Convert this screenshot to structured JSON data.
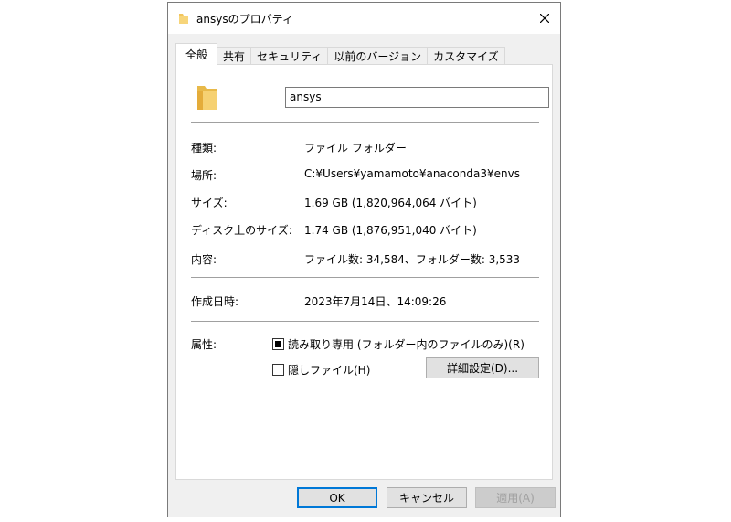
{
  "window": {
    "title": "ansysのプロパティ"
  },
  "tabs": [
    {
      "label": "全般"
    },
    {
      "label": "共有"
    },
    {
      "label": "セキュリティ"
    },
    {
      "label": "以前のバージョン"
    },
    {
      "label": "カスタマイズ"
    }
  ],
  "general": {
    "folder_name": "ansys",
    "rows": [
      {
        "label": "種類:",
        "value": "ファイル フォルダー"
      },
      {
        "label": "場所:",
        "value": "C:¥Users¥yamamoto¥anaconda3¥envs"
      },
      {
        "label": "サイズ:",
        "value": "1.69 GB (1,820,964,064 バイト)"
      },
      {
        "label": "ディスク上のサイズ:",
        "value": "1.74 GB (1,876,951,040 バイト)"
      },
      {
        "label": "内容:",
        "value": "ファイル数: 34,584、フォルダー数: 3,533"
      }
    ],
    "created": {
      "label": "作成日時:",
      "value": "2023年7月14日、14:09:26"
    },
    "attributes": {
      "label": "属性:",
      "readonly_label": "読み取り専用 (フォルダー内のファイルのみ)(R)",
      "hidden_label": "隠しファイル(H)",
      "advanced_button": "詳細設定(D)..."
    }
  },
  "footer": {
    "ok": "OK",
    "cancel": "キャンセル",
    "apply": "適用(A)"
  },
  "colors": {
    "folder": "#f2c55c",
    "accent": "#0078d7"
  }
}
